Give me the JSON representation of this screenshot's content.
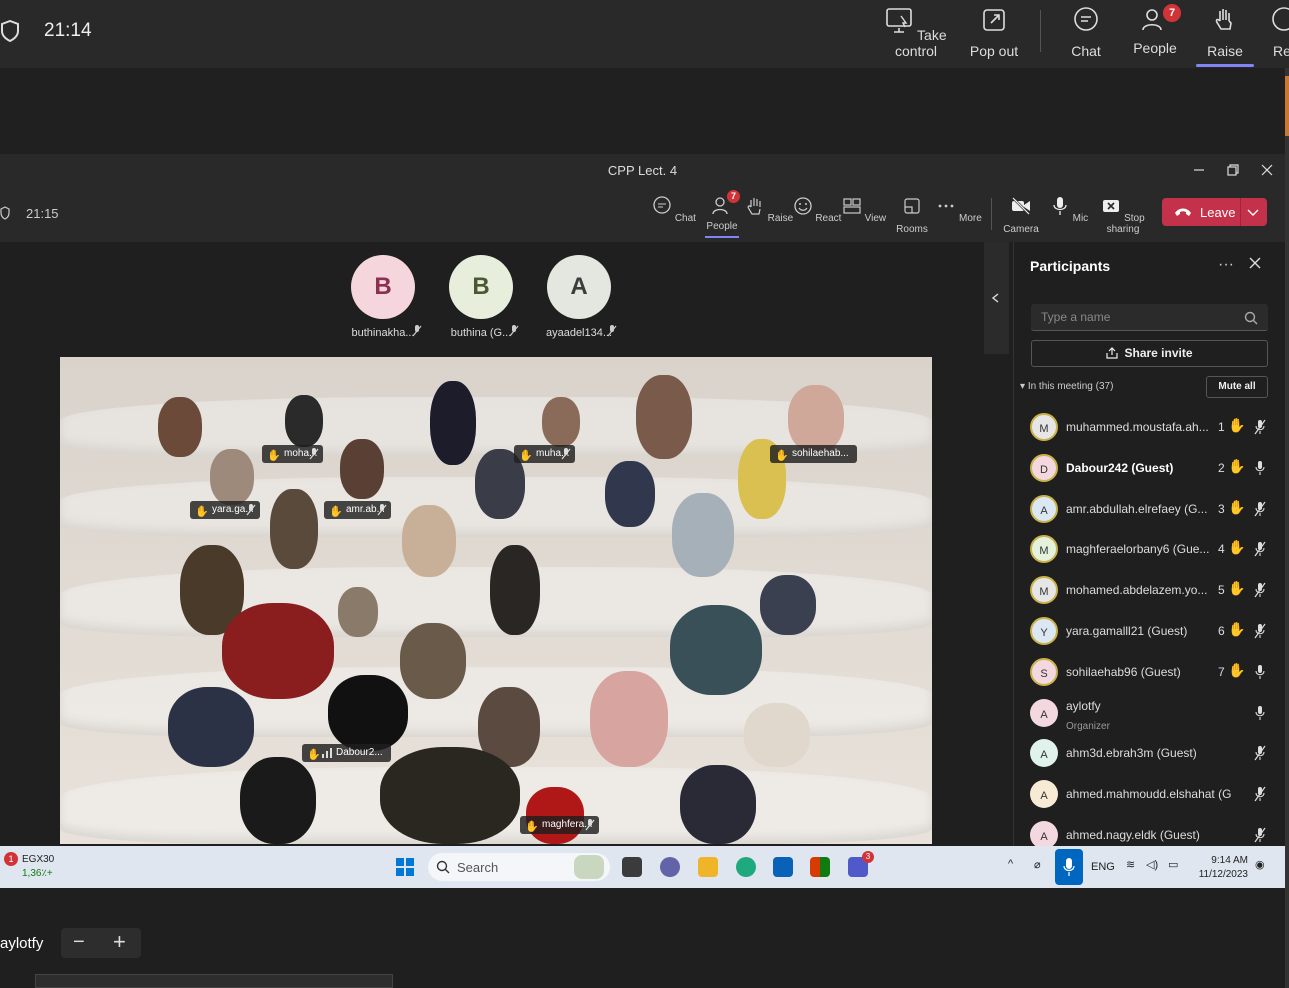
{
  "outer": {
    "clock": "21:14",
    "buttons": [
      {
        "label": "Take control",
        "icon": "take-control-icon"
      },
      {
        "label": "Pop out",
        "icon": "pop-out-icon"
      },
      {
        "label": "Chat",
        "icon": "chat-icon"
      },
      {
        "label": "People",
        "icon": "people-icon",
        "badge": "7"
      },
      {
        "label": "Raise",
        "icon": "raise-hand-icon"
      },
      {
        "label": "Re",
        "icon": "react-icon"
      }
    ]
  },
  "window": {
    "title": "CPP Lect. 4",
    "clock": "21:15",
    "toolbar": [
      {
        "label": "Chat",
        "icon": "chat-icon"
      },
      {
        "label": "People",
        "icon": "people-icon",
        "badge": "7"
      },
      {
        "label": "Raise",
        "icon": "raise-hand-icon"
      },
      {
        "label": "React",
        "icon": "react-icon"
      },
      {
        "label": "View",
        "icon": "view-icon"
      },
      {
        "label": "Rooms",
        "icon": "rooms-icon"
      },
      {
        "label": "More",
        "icon": "more-icon"
      },
      {
        "label": "Camera",
        "icon": "camera-off-icon"
      },
      {
        "label": "Mic",
        "icon": "mic-icon"
      },
      {
        "label": "Stop sharing",
        "icon": "stop-sharing-icon"
      }
    ],
    "leave_label": "Leave"
  },
  "stage": {
    "avatars": [
      {
        "initial": "B",
        "name": "buthinakha...",
        "bg": "#f5d6dc",
        "fg": "#8a3050"
      },
      {
        "initial": "B",
        "name": "buthina (G...",
        "bg": "#e8eedc",
        "fg": "#4a5a30"
      },
      {
        "initial": "A",
        "name": "ayaadel134...",
        "bg": "#e4e6e0",
        "fg": "#3c3c3c"
      }
    ],
    "nametags": [
      "moha...",
      "muha...",
      "sohilaehab...",
      "yara.ga...",
      "amr.ab...",
      "Dabour2...",
      "maghfera..."
    ]
  },
  "panel": {
    "title": "Participants",
    "search_placeholder": "Type a name",
    "share_label": "Share invite",
    "in_meeting": "In this meeting (37)",
    "mute_all": "Mute all",
    "participants": [
      {
        "initial": "M",
        "name": "muhammed.moustafa.ah...",
        "num": "1",
        "hand": true,
        "muted": true,
        "bg": "#e6e6e6"
      },
      {
        "initial": "D",
        "name": "Dabour242 (Guest)",
        "num": "2",
        "hand": true,
        "muted": false,
        "bold": true,
        "bg": "#f3d8df"
      },
      {
        "initial": "A",
        "name": "amr.abdullah.elrefaey (G...",
        "num": "3",
        "hand": true,
        "muted": true,
        "bg": "#dbe7f3"
      },
      {
        "initial": "M",
        "name": "maghferaelorbany6 (Gue...",
        "num": "4",
        "hand": true,
        "muted": true,
        "bg": "#e3f1dd"
      },
      {
        "initial": "M",
        "name": "mohamed.abdelazem.yo...",
        "num": "5",
        "hand": true,
        "muted": true,
        "bg": "#e6e6e6"
      },
      {
        "initial": "Y",
        "name": "yara.gamalll21 (Guest)",
        "num": "6",
        "hand": true,
        "muted": true,
        "bg": "#dbe7f3"
      },
      {
        "initial": "S",
        "name": "sohilaehab96 (Guest)",
        "num": "7",
        "hand": true,
        "muted": false,
        "bg": "#f3d8df"
      },
      {
        "initial": "A",
        "name": "aylotfy",
        "sub": "Organizer",
        "num": "",
        "hand": false,
        "muted": false,
        "bg": "#f3d8df"
      },
      {
        "initial": "A",
        "name": "ahm3d.ebrah3m (Guest)",
        "num": "",
        "hand": false,
        "muted": true,
        "bg": "#dff2ec"
      },
      {
        "initial": "A",
        "name": "ahmed.mahmoudd.elshahat (Gu...",
        "num": "",
        "hand": false,
        "muted": true,
        "bg": "#f7ebd6"
      },
      {
        "initial": "A",
        "name": "ahmed.nagy.eldk (Guest)",
        "num": "",
        "hand": false,
        "muted": true,
        "bg": "#f3d8df"
      }
    ]
  },
  "taskbar": {
    "stock_badge": "1",
    "stock_name": "EGX30",
    "stock_change": "1,36٪+",
    "search_label": "Search",
    "lang": "ENG",
    "time": "9:14 AM",
    "date": "11/12/2023",
    "teams_badge": "3"
  },
  "bottom": {
    "name": "aylotfy"
  }
}
